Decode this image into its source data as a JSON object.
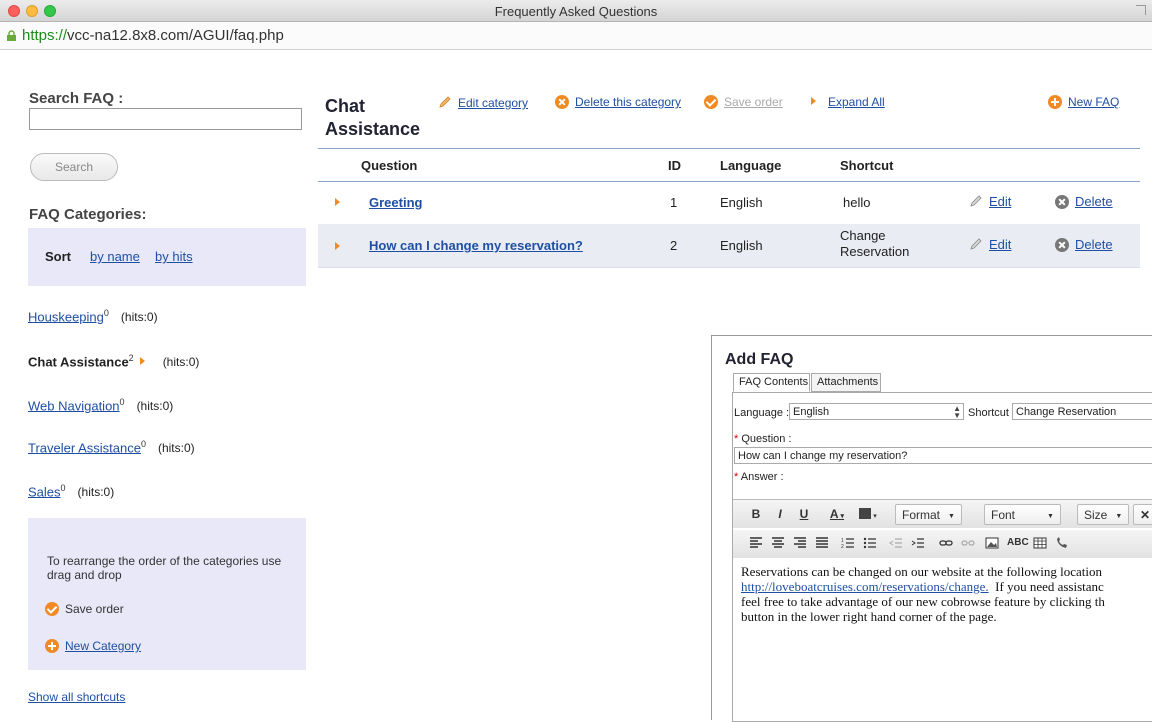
{
  "window": {
    "title": "Frequently Asked Questions"
  },
  "address": {
    "scheme": "https://",
    "host_path": "vcc-na12.8x8.com/AGUI/faq.php"
  },
  "search": {
    "label": "Search FAQ :",
    "value": "",
    "button": "Search"
  },
  "categories": {
    "heading": "FAQ Categories:",
    "sort_label": "Sort",
    "sort_by_name": "by name",
    "sort_by_hits": "by hits",
    "items": [
      {
        "name": "Houskeeping",
        "count": "0",
        "hits": "(hits:0)"
      },
      {
        "name": "Chat Assistance",
        "count": "2",
        "hits": "(hits:0)"
      },
      {
        "name": "Web Navigation",
        "count": "0",
        "hits": "(hits:0)"
      },
      {
        "name": "Traveler Assistance",
        "count": "0",
        "hits": "(hits:0)"
      },
      {
        "name": "Sales",
        "count": "0",
        "hits": "(hits:0)"
      }
    ],
    "help_text": "To rearrange the order of the categories use drag and drop",
    "save_order": "Save order",
    "new_category": "New Category",
    "show_shortcuts": "Show all shortcuts"
  },
  "main": {
    "category_title": "Chat Assistance",
    "edit_category": "Edit category",
    "delete_category": "Delete this category",
    "save_order": "Save order",
    "expand_all": "Expand All",
    "new_faq": "New FAQ",
    "columns": [
      "Question",
      "ID",
      "Language",
      "Shortcut"
    ],
    "rows": [
      {
        "question": "Greeting",
        "id": "1",
        "language": "English",
        "shortcut_line1": "hello",
        "shortcut_line2": "",
        "edit": "Edit",
        "delete": "Delete"
      },
      {
        "question": "How can I change my reservation?",
        "id": "2",
        "language": "English",
        "shortcut_line1": "Change",
        "shortcut_line2": "Reservation",
        "edit": "Edit",
        "delete": "Delete"
      }
    ]
  },
  "dialog": {
    "title": "Add FAQ",
    "tabs": [
      "FAQ Contents",
      "Attachments"
    ],
    "language_label": "Language :",
    "language_value": "English",
    "shortcut_label": "Shortcut :",
    "shortcut_value": "Change Reservation",
    "question_label": "Question :",
    "question_value": "How can I change my reservation?",
    "answer_label": "Answer :",
    "toolbar": {
      "bold": "B",
      "italic": "I",
      "underline": "U",
      "text_color": "A",
      "format": "Format",
      "font": "Font",
      "size": "Size"
    },
    "answer_lines": [
      "Reservations can be changed on our website at the following location",
      "http://loveboatcruises.com/reservations/change.",
      "  If you need assistanc",
      "feel free to take advantage of our new cobrowse feature by clicking th",
      "button in the lower right hand corner of the page."
    ]
  },
  "colors": {
    "accent_orange": "#f08a24",
    "link_blue": "#1f4fa3",
    "panel_lavender": "#e8e8f8",
    "row_alt": "#e9ecf3"
  }
}
